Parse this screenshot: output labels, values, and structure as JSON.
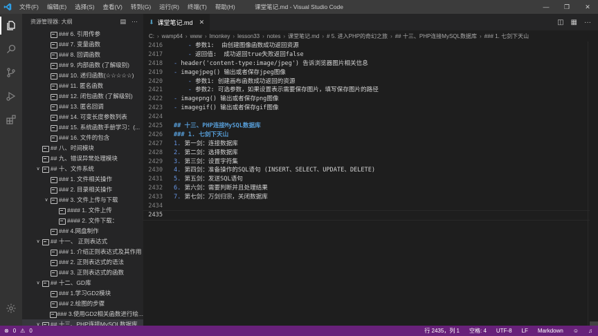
{
  "titlebar": {
    "menu": [
      "文件(F)",
      "编辑(E)",
      "选择(S)",
      "查看(V)",
      "转到(G)",
      "运行(R)",
      "终端(T)",
      "帮助(H)"
    ],
    "window_title": "课堂笔记.md - Visual Studio Code",
    "controls": [
      "minimize-icon",
      "restore-icon",
      "close-icon"
    ]
  },
  "activitybar": {
    "items": [
      "explorer-icon",
      "search-icon",
      "source-control-icon",
      "run-debug-icon",
      "extensions-icon"
    ],
    "bottom": "settings-gear-icon"
  },
  "sidebar": {
    "title": "资源管理器: 大纲",
    "outline": [
      {
        "depth": 2,
        "twisty": "",
        "label": "### 6. 引用传参"
      },
      {
        "depth": 2,
        "twisty": "",
        "label": "### 7. 变量函数"
      },
      {
        "depth": 2,
        "twisty": "",
        "label": "### 8. 回调函数"
      },
      {
        "depth": 2,
        "twisty": "",
        "label": "### 9. 内部函数 (了解级别)"
      },
      {
        "depth": 2,
        "twisty": "",
        "label": "### 10. 递归函数(☆☆☆☆☆)"
      },
      {
        "depth": 2,
        "twisty": "",
        "label": "### 11. 匿名函数"
      },
      {
        "depth": 2,
        "twisty": "",
        "label": "### 12. 闭包函数 (了解级别)"
      },
      {
        "depth": 2,
        "twisty": "",
        "label": "### 13. 匿名回调"
      },
      {
        "depth": 2,
        "twisty": "",
        "label": "### 14. 可变长度参数列表"
      },
      {
        "depth": 2,
        "twisty": "",
        "label": "### 15. 系统函数手册学习：(..."
      },
      {
        "depth": 2,
        "twisty": "",
        "label": "### 16. 文件的包含"
      },
      {
        "depth": 1,
        "twisty": "",
        "label": "## 八、时间模块"
      },
      {
        "depth": 1,
        "twisty": "",
        "label": "## 九、错误异常处理模块"
      },
      {
        "depth": 1,
        "twisty": "v",
        "label": "## 十、文件系统"
      },
      {
        "depth": 2,
        "twisty": "",
        "label": "### 1. 文件相关操作"
      },
      {
        "depth": 2,
        "twisty": "",
        "label": "### 2. 目录相关操作"
      },
      {
        "depth": 2,
        "twisty": "v",
        "label": "### 3. 文件上传与下载"
      },
      {
        "depth": 3,
        "twisty": "",
        "label": "#### 1. 文件上传"
      },
      {
        "depth": 3,
        "twisty": "",
        "label": "#### 2. 文件下载："
      },
      {
        "depth": 2,
        "twisty": "",
        "label": "### 4.网盘制作"
      },
      {
        "depth": 1,
        "twisty": "v",
        "label": "## 十一、 正则表达式"
      },
      {
        "depth": 2,
        "twisty": "",
        "label": "### 1. 介绍正则表达式及其作用"
      },
      {
        "depth": 2,
        "twisty": "",
        "label": "### 2. 正则表达式的语法"
      },
      {
        "depth": 2,
        "twisty": "",
        "label": "### 3. 正则表达式的函数"
      },
      {
        "depth": 1,
        "twisty": "v",
        "label": "## 十二、GD库"
      },
      {
        "depth": 2,
        "twisty": "",
        "label": "### 1.学习GD2模块"
      },
      {
        "depth": 2,
        "twisty": "",
        "label": "### 2.绘图的步骤"
      },
      {
        "depth": 2,
        "twisty": "",
        "label": "### 3.使用GD2相关函数进行绘..."
      },
      {
        "depth": 1,
        "twisty": "v",
        "label": "## 十三、PHP连接MySQL数据库",
        "selected": true
      }
    ]
  },
  "editor": {
    "tab": {
      "label": "课堂笔记.md",
      "icon": "markdown-icon"
    },
    "actions": [
      "split-editor-icon",
      "preview-icon",
      "more-actions-icon"
    ],
    "breadcrumb": [
      "C:",
      "wamp64",
      "www",
      "lmonkey",
      "lesson33",
      "notes",
      "课堂笔记.md",
      "# 5. 进入PHP的奇幻之旅",
      "## 十三、PHP连接MySQL数据库",
      "### 1. 七剑下天山"
    ],
    "lines": [
      {
        "n": "2416",
        "indent": "    ",
        "marker": "- ",
        "text": "参数1:  由创建图像函数成功返回资源",
        "kind": "plain"
      },
      {
        "n": "2417",
        "indent": "    ",
        "marker": "- ",
        "text": "返回值:  成功返回true失败返回false",
        "kind": "plain"
      },
      {
        "n": "2418",
        "indent": "",
        "marker": "- ",
        "text": "header('content-type:image/jpeg') 告诉浏览器图片相关信息",
        "kind": "plain"
      },
      {
        "n": "2419",
        "indent": "",
        "marker": "- ",
        "text": "imagejpeg() 输出或者保存jpeg图像",
        "kind": "plain"
      },
      {
        "n": "2420",
        "indent": "    ",
        "marker": "- ",
        "text": "参数1: 创建画布函数成功返回的资源",
        "kind": "plain"
      },
      {
        "n": "2421",
        "indent": "    ",
        "marker": "- ",
        "text": "参数2: 可选参数，如果设置表示需要保存图片，填写保存图片的路径",
        "kind": "plain"
      },
      {
        "n": "2422",
        "indent": "",
        "marker": "- ",
        "text": "imagepng() 输出或者保存png图像",
        "kind": "plain"
      },
      {
        "n": "2423",
        "indent": "",
        "marker": "- ",
        "text": "imagegif() 输出或者保存gif图像",
        "kind": "plain"
      },
      {
        "n": "2424",
        "indent": "",
        "marker": "",
        "text": "",
        "kind": "plain"
      },
      {
        "n": "2425",
        "indent": "",
        "marker": "",
        "text": "## 十三、PHP连接MySQL数据库",
        "kind": "heading"
      },
      {
        "n": "2426",
        "indent": "",
        "marker": "",
        "text": "### 1. 七剑下天山",
        "kind": "heading"
      },
      {
        "n": "2427",
        "indent": "",
        "marker": "1. ",
        "text": "第一剑：连接数据库",
        "kind": "numbered"
      },
      {
        "n": "2428",
        "indent": "",
        "marker": "2. ",
        "text": "第二剑：选择数据库",
        "kind": "numbered"
      },
      {
        "n": "2429",
        "indent": "",
        "marker": "3. ",
        "text": "第三剑：设置字符集",
        "kind": "numbered"
      },
      {
        "n": "2430",
        "indent": "",
        "marker": "4. ",
        "text": "第四剑：准备操作的SQL语句 (INSERT、SELECT、UPDATE、DELETE)",
        "kind": "numbered"
      },
      {
        "n": "2431",
        "indent": "",
        "marker": "5. ",
        "text": "第五剑：发送SQL语句",
        "kind": "numbered"
      },
      {
        "n": "2432",
        "indent": "",
        "marker": "6. ",
        "text": "第六剑：需要判断并且处理结果",
        "kind": "numbered"
      },
      {
        "n": "2433",
        "indent": "",
        "marker": "7. ",
        "text": "第七剑：万剑归宗，关闭数据库",
        "kind": "numbered"
      },
      {
        "n": "2434",
        "indent": "",
        "marker": "",
        "text": "",
        "kind": "plain"
      },
      {
        "n": "2435",
        "indent": "",
        "marker": "",
        "text": "",
        "kind": "plain",
        "current": true
      }
    ]
  },
  "statusbar": {
    "errors": "0",
    "warnings": "0",
    "position": "行 2435，列 1",
    "spaces": "空格: 4",
    "encoding": "UTF-8",
    "eol": "LF",
    "language": "Markdown",
    "feedback_icon": "feedback-icon",
    "bell_icon": "bell-icon"
  }
}
